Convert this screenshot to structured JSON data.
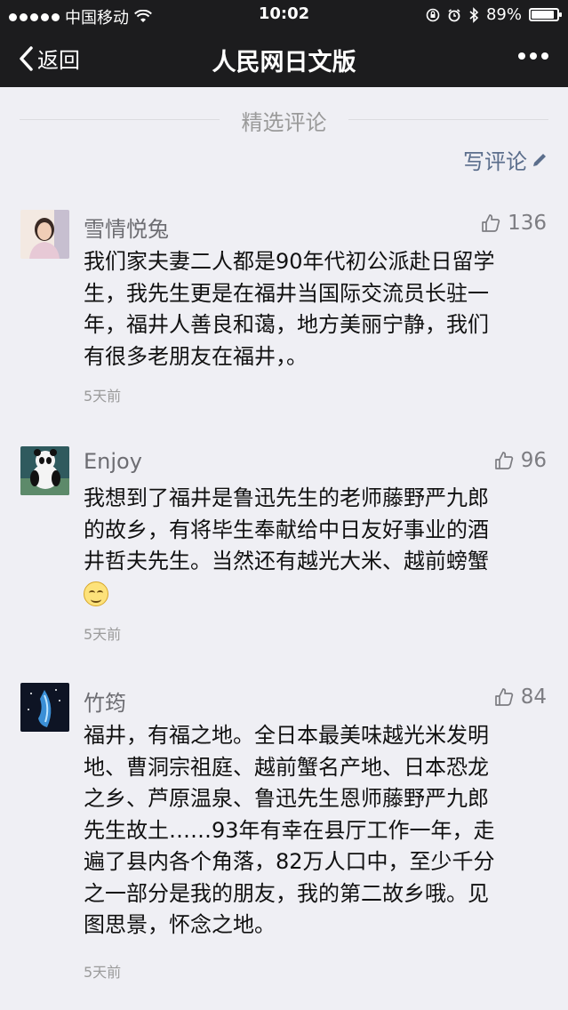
{
  "status_bar": {
    "carrier": "中国移动",
    "time": "10:02",
    "battery": "89%"
  },
  "nav": {
    "back_label": "返回",
    "title": "人民网日文版"
  },
  "section": {
    "title": "精选评论",
    "write_label": "写评论"
  },
  "comments": [
    {
      "name": "雪情悦兔",
      "likes": "136",
      "lines": [
        "我们家夫妻二人都是90年代初公派赴日留学",
        "生，我先生更是在福井当国际交流员长驻一",
        "年，福井人善良和蔼，地方美丽宁静，我们",
        "有很多老朋友在福井，。"
      ],
      "time": "5天前"
    },
    {
      "name": "Enjoy",
      "likes": "96",
      "lines": [
        "我想到了福井是鲁迅先生的老师藤野严九郎",
        "的故乡，有将毕生奉献给中日友好事业的酒",
        "井哲夫先生。当然还有越光大米、越前螃蟹"
      ],
      "emoji": "smile-emoji",
      "time": "5天前"
    },
    {
      "name": "竹筠",
      "likes": "84",
      "lines": [
        "福井，有福之地。全日本最美味越光米发明",
        "地、曹洞宗祖庭、越前蟹名产地、日本恐龙",
        "之乡、芦原温泉、鲁迅先生恩师藤野严九郎",
        "先生故土……93年有幸在县厅工作一年，走",
        "遍了县内各个角落，82万人口中，至少千分",
        "之一部分是我的朋友，我的第二故乡哦。见",
        "图思景，怀念之地。"
      ],
      "time": "5天前"
    }
  ]
}
